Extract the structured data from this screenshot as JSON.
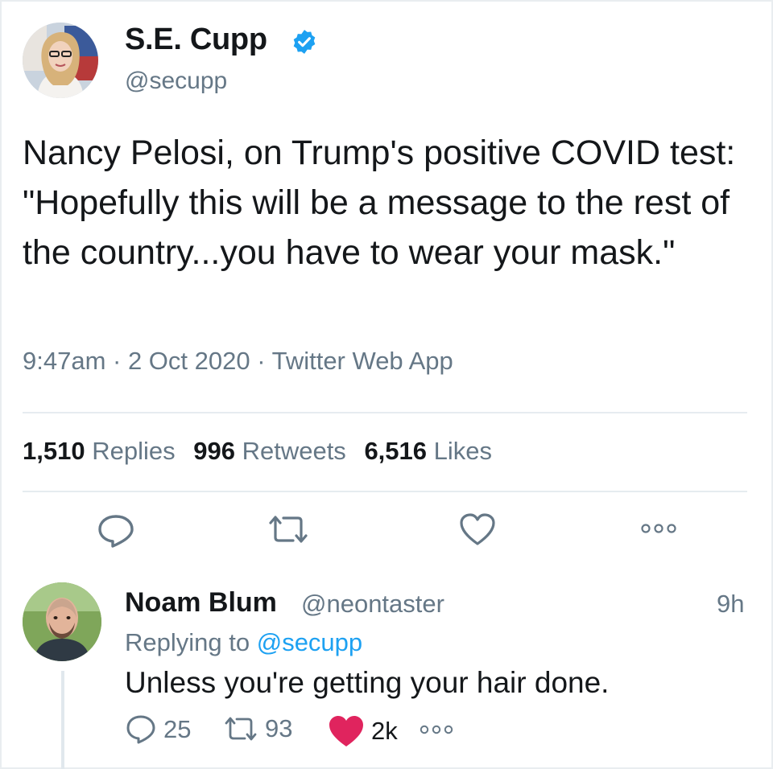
{
  "tweet": {
    "author": {
      "name": "S.E. Cupp",
      "handle": "@secupp",
      "verified": true,
      "verified_icon": "verified-badge-icon"
    },
    "text": "Nancy Pelosi, on Trump's positive COVID test: \"Hopefully this will be a message to the rest of the country...you have to wear your mask.\"",
    "meta": "9:47am · 2 Oct 2020 · Twitter Web App",
    "stats": {
      "replies_count": "1,510",
      "replies_label": "Replies",
      "retweets_count": "996",
      "retweets_label": "Retweets",
      "likes_count": "6,516",
      "likes_label": "Likes"
    },
    "actions": [
      "reply-icon",
      "retweet-icon",
      "like-icon",
      "more-icon"
    ]
  },
  "reply": {
    "author": {
      "name": "Noam Blum",
      "handle": "@neontaster"
    },
    "time": "9h",
    "replying_prefix": "Replying to",
    "replying_to": "@secupp",
    "text": "Unless you're getting your hair done.",
    "counts": {
      "replies": "25",
      "retweets": "93",
      "likes": "2k"
    }
  },
  "colors": {
    "accent_blue": "#1da1f2",
    "secondary_text": "#657786",
    "like_red": "#e0245e"
  }
}
